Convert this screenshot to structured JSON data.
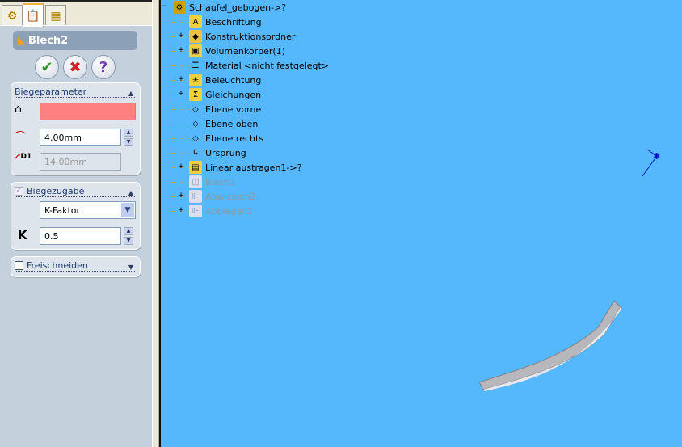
{
  "panel": {
    "tabs": [
      {
        "icon": "feature-manager-icon"
      },
      {
        "icon": "property-manager-icon"
      },
      {
        "icon": "configuration-manager-icon"
      }
    ],
    "feature_title": "Blech2",
    "buttons": {
      "ok": "✔",
      "cancel": "✖",
      "help": "?"
    },
    "bend_params": {
      "title": "Biegeparameter",
      "face_value": "",
      "radius": "4.00mm",
      "thickness": "14.00mm",
      "thickness_label": "D1"
    },
    "bend_allowance": {
      "title": "Biegezugabe",
      "checked": true,
      "type": "K-Faktor",
      "k_label": "K",
      "k_value": "0.5"
    },
    "relief": {
      "title": "Freischneiden",
      "checked": false
    }
  },
  "colors": {
    "viewport": "#55b8fc",
    "face_selection": "#ff8080",
    "panel": "#c4d0dc"
  },
  "tree": [
    {
      "label": "Schaufel_gebogen->?",
      "icon": "part-icon",
      "expander": "−",
      "gray": false
    },
    {
      "label": "Beschriftung",
      "icon": "annotations-icon",
      "expander": "",
      "gray": false
    },
    {
      "label": "Konstruktionsordner",
      "icon": "design-binder-icon",
      "expander": "+",
      "gray": false
    },
    {
      "label": "Volumenkörper(1)",
      "icon": "solid-bodies-icon",
      "expander": "+",
      "gray": false
    },
    {
      "label": "Material <nicht festgelegt>",
      "icon": "material-icon",
      "expander": "",
      "gray": false
    },
    {
      "label": "Beleuchtung",
      "icon": "lighting-icon",
      "expander": "+",
      "gray": false
    },
    {
      "label": "Gleichungen",
      "icon": "equations-icon",
      "expander": "+",
      "gray": false
    },
    {
      "label": "Ebene vorne",
      "icon": "plane-icon",
      "expander": "",
      "gray": false
    },
    {
      "label": "Ebene oben",
      "icon": "plane-icon",
      "expander": "",
      "gray": false
    },
    {
      "label": "Ebene rechts",
      "icon": "plane-icon",
      "expander": "",
      "gray": false
    },
    {
      "label": "Ursprung",
      "icon": "origin-icon",
      "expander": "",
      "gray": false
    },
    {
      "label": "Linear austragen1->?",
      "icon": "extrude-icon",
      "expander": "+",
      "gray": false
    },
    {
      "label": "Blech2",
      "icon": "sheet-metal-icon",
      "expander": "",
      "gray": true
    },
    {
      "label": "Abwickeln2",
      "icon": "unfold-icon",
      "expander": "+",
      "gray": true
    },
    {
      "label": "Abbiegen2",
      "icon": "fold-icon",
      "expander": "+",
      "gray": true
    }
  ]
}
